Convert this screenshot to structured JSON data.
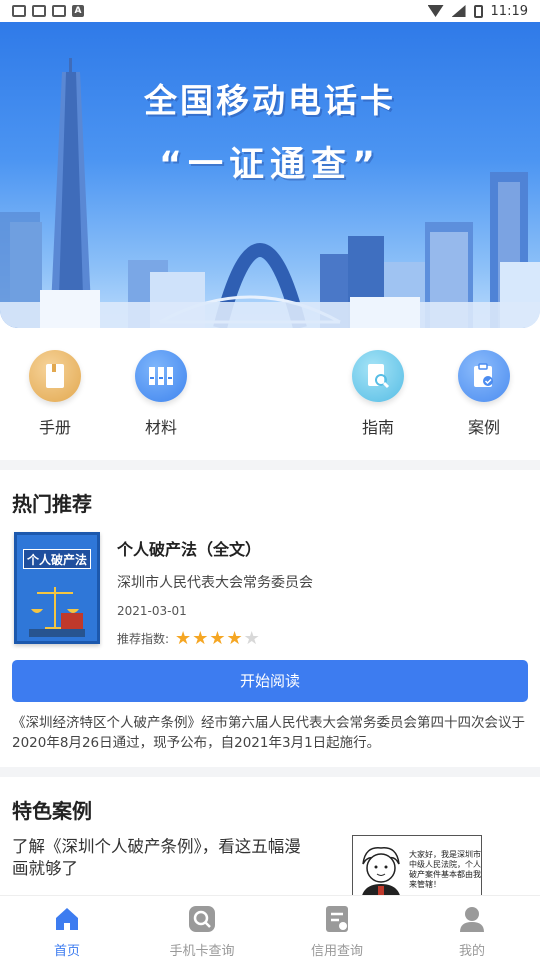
{
  "status_bar": {
    "time": "11:19"
  },
  "banner": {
    "title": "全国移动电话卡",
    "subtitle": "“一证通查”"
  },
  "quick_menu": [
    {
      "label": "手册",
      "icon": "book-icon"
    },
    {
      "label": "材料",
      "icon": "binders-icon"
    },
    {
      "label": "指南",
      "icon": "document-search-icon"
    },
    {
      "label": "案例",
      "icon": "clipboard-check-icon"
    }
  ],
  "hot": {
    "section_title": "热门推荐",
    "book": {
      "cover_title": "个人破产法",
      "title": "个人破产法（全文）",
      "author": "深圳市人民代表大会常务委员会",
      "date": "2021-03-01",
      "rating_label": "推荐指数:",
      "rating": 4,
      "rating_max": 5
    },
    "read_button": "开始阅读",
    "description": "《深圳经济特区个人破产条例》经市第六届人民代表大会常务委员会第四十四次会议于2020年8月26日通过，现予公布，自2021年3月1日起施行。"
  },
  "featured": {
    "section_title": "特色案例",
    "case_text": "了解《深圳个人破产条例》，看这五幅漫画就够了",
    "comic_text": "大家好，我是深圳市中级人民法院，个人破产案件基本都由我来管辖！"
  },
  "bottom_nav": [
    {
      "label": "首页",
      "icon": "home-icon",
      "active": true
    },
    {
      "label": "手机卡查询",
      "icon": "search-icon",
      "active": false
    },
    {
      "label": "信用查询",
      "icon": "credit-doc-icon",
      "active": false
    },
    {
      "label": "我的",
      "icon": "user-icon",
      "active": false
    }
  ],
  "colors": {
    "primary": "#3d7cf0",
    "star": "#f5a623",
    "inactive_nav": "#999999"
  }
}
